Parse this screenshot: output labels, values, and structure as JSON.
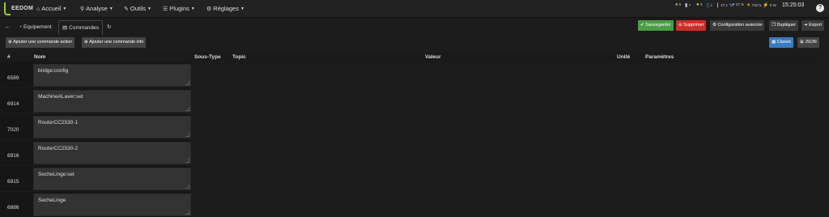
{
  "navbar": {
    "logo_text": "EEDOM",
    "items": [
      {
        "label": "Accueil",
        "icon": "home-icon"
      },
      {
        "label": "Analyse",
        "icon": "analysis-icon"
      },
      {
        "label": "Outils",
        "icon": "wrench-icon"
      },
      {
        "label": "Plugins",
        "icon": "list-icon"
      },
      {
        "label": "Réglages",
        "icon": "gear-icon"
      }
    ],
    "status": [
      {
        "value": "5",
        "color": "#9c3"
      },
      {
        "value": "7",
        "color": "#ccc"
      },
      {
        "value": "0",
        "color": "#ec3"
      },
      {
        "value": "1",
        "color": "#5af"
      },
      {
        "value": "27.1 °C",
        "color": "#f93"
      },
      {
        "value": "27 %",
        "color": "#5af"
      },
      {
        "value": "732 lx",
        "color": "#fc3"
      },
      {
        "value": "0 W",
        "color": "#fc3"
      }
    ],
    "clock": "15:25:03",
    "help": "?"
  },
  "tabs": {
    "back_icon": "←",
    "equipment": "Equipement",
    "commands": "Commandes",
    "refresh_icon": "↻"
  },
  "toolbar": {
    "save": "Sauvegarder",
    "delete": "Supprimer",
    "advanced": "Configuration avancée",
    "duplicate": "Dupliquer",
    "export": "Export",
    "classic": "Classic",
    "json": "JSON"
  },
  "actions": {
    "add_action": "Ajouter une commande action",
    "add_info": "Ajouter une commande info"
  },
  "table": {
    "headers": {
      "id": "#",
      "name": "Nom",
      "subtype": "Sous-Type",
      "topic": "Topic",
      "value": "Valeur",
      "unit": "Unité",
      "params": "Paramètres"
    },
    "rows": [
      {
        "id": "6589",
        "name": "bridge:config"
      },
      {
        "id": "6914",
        "name": "MachineALaver:set"
      },
      {
        "id": "7020",
        "name": "RouterCC2530-1"
      },
      {
        "id": "6916",
        "name": "RouterCC2530-2"
      },
      {
        "id": "6915",
        "name": "SecheLinge:set"
      },
      {
        "id": "6886",
        "name": "SecheLinge"
      }
    ]
  }
}
